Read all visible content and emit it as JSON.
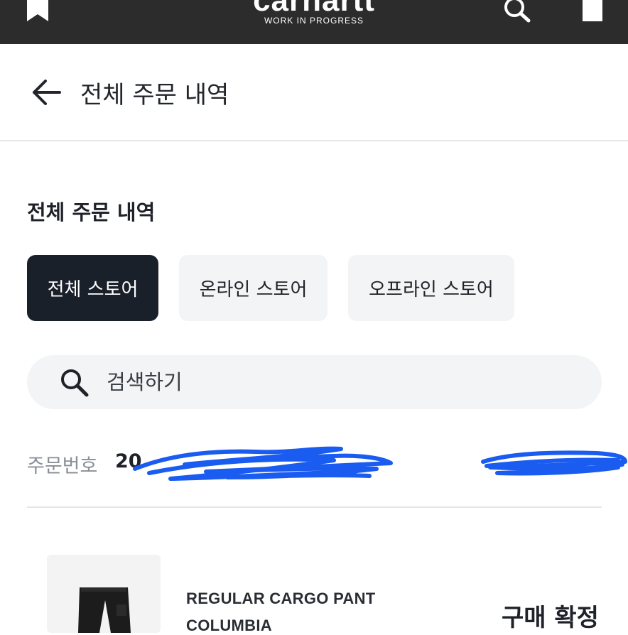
{
  "brand": {
    "logo_text": "carhartt",
    "tagline": "WORK IN PROGRESS"
  },
  "header": {
    "title": "전체 주문 내역"
  },
  "section": {
    "title": "전체 주문 내역"
  },
  "filters": {
    "all": "전체 스토어",
    "online": "온라인 스토어",
    "offline": "오프라인 스토어",
    "selected": "전체 스토어"
  },
  "search": {
    "placeholder": "검색하기",
    "value": ""
  },
  "order": {
    "label": "주문번호",
    "number_visible": "20"
  },
  "product": {
    "name": "REGULAR CARGO PANT",
    "color": "COLUMBIA",
    "status": "구매 확정"
  },
  "colors": {
    "topbar": "#2c2c2c",
    "chip_active": "#1a2029",
    "chip_inactive": "#f2f4f6",
    "redaction": "#1a5cf0"
  },
  "icons": [
    "bookmark-icon",
    "search-icon",
    "bag-icon",
    "back-arrow-icon",
    "search-icon"
  ]
}
